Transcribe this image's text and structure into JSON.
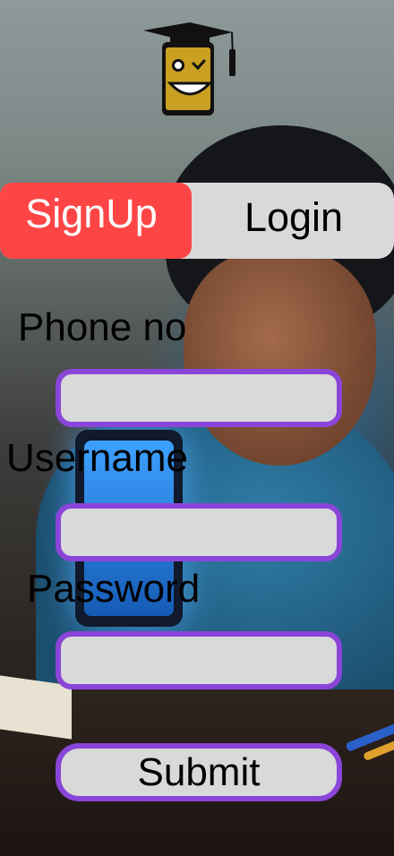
{
  "logo": {
    "icon": "graduation-cap-phone-mascot-icon"
  },
  "tabs": {
    "signup_label": "SignUp",
    "login_label": "Login",
    "active": "SignUp",
    "active_color": "#FE4545",
    "inactive_color": "#D9D9D9"
  },
  "form": {
    "phone_label": "Phone no",
    "phone_value": "",
    "username_label": "Username",
    "username_value": "",
    "password_label": "Password",
    "password_value": "",
    "field_border_color": "#8A45D8",
    "submit_label": "Submit"
  }
}
